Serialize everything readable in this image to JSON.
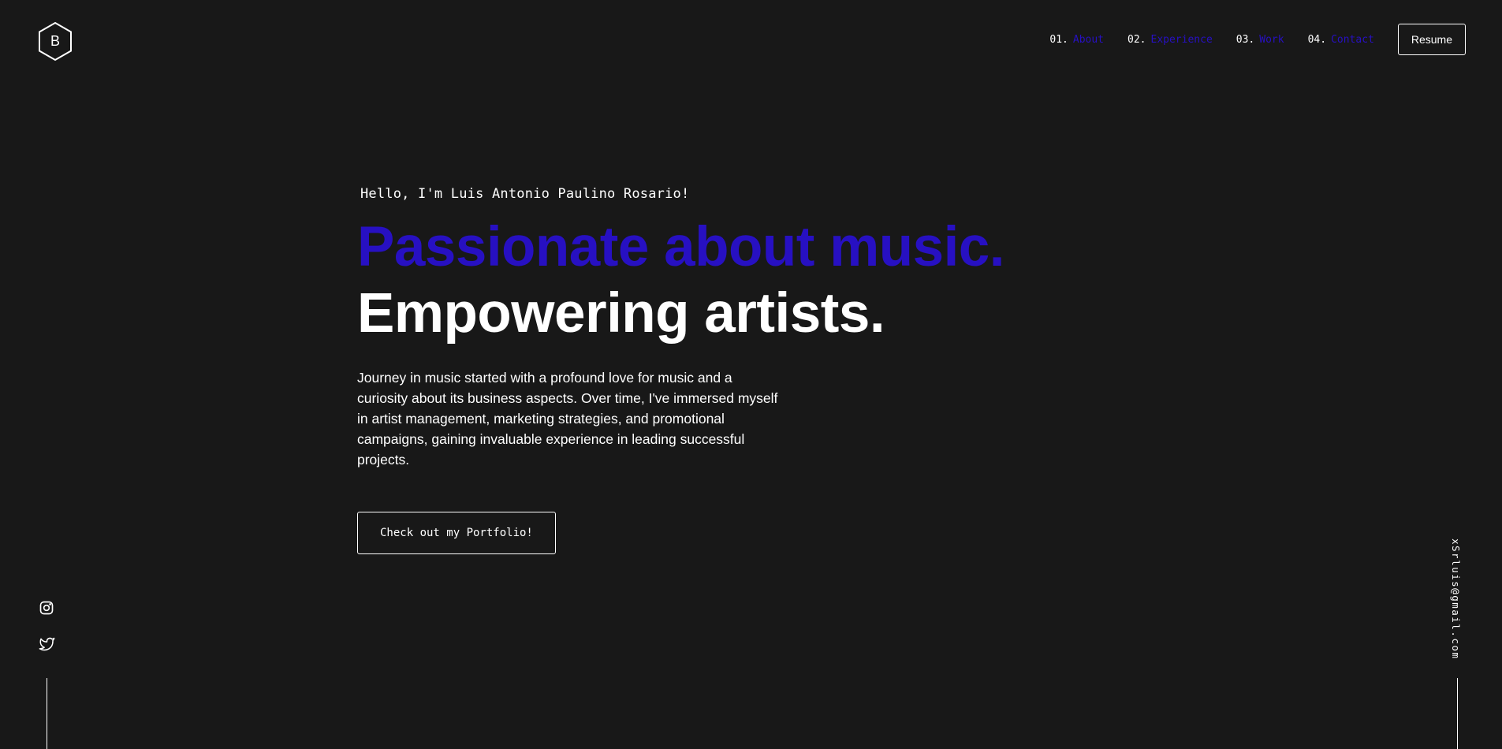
{
  "logo": {
    "letter": "B",
    "icon": "hexagon-logo-icon"
  },
  "nav": {
    "items": [
      {
        "num": "01.",
        "label": "About"
      },
      {
        "num": "02.",
        "label": "Experience"
      },
      {
        "num": "03.",
        "label": "Work"
      },
      {
        "num": "04.",
        "label": "Contact"
      }
    ],
    "resume_label": "Resume"
  },
  "hero": {
    "greeting": "Hello, I'm Luis Antonio Paulino Rosario!",
    "headline_1": "Passionate about music.",
    "headline_2": "Empowering artists.",
    "intro": "Journey in music started with a profound love for music and a curiosity about its business aspects. Over time, I've immersed myself in artist management, marketing strategies, and promotional campaigns, gaining invaluable experience in leading successful projects.",
    "cta_label": "Check out my Portfolio!"
  },
  "social": {
    "items": [
      {
        "icon": "instagram-icon"
      },
      {
        "icon": "twitter-icon"
      }
    ]
  },
  "email": "xSrluis@gmail.com",
  "colors": {
    "background": "#181818",
    "accent": "#2710c2",
    "text": "#ffffff"
  }
}
